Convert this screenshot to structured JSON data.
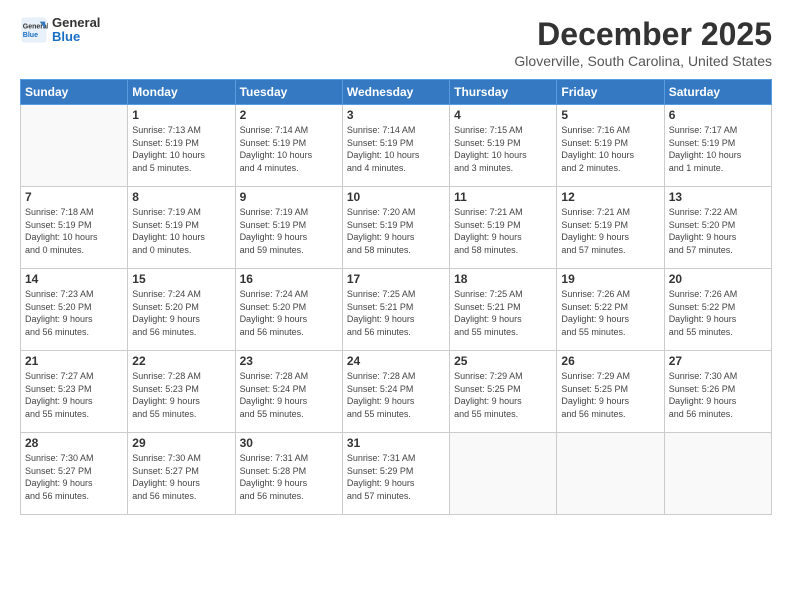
{
  "logo": {
    "line1": "General",
    "line2": "Blue"
  },
  "title": "December 2025",
  "location": "Gloverville, South Carolina, United States",
  "weekdays": [
    "Sunday",
    "Monday",
    "Tuesday",
    "Wednesday",
    "Thursday",
    "Friday",
    "Saturday"
  ],
  "weeks": [
    [
      {
        "day": "",
        "info": ""
      },
      {
        "day": "1",
        "info": "Sunrise: 7:13 AM\nSunset: 5:19 PM\nDaylight: 10 hours\nand 5 minutes."
      },
      {
        "day": "2",
        "info": "Sunrise: 7:14 AM\nSunset: 5:19 PM\nDaylight: 10 hours\nand 4 minutes."
      },
      {
        "day": "3",
        "info": "Sunrise: 7:14 AM\nSunset: 5:19 PM\nDaylight: 10 hours\nand 4 minutes."
      },
      {
        "day": "4",
        "info": "Sunrise: 7:15 AM\nSunset: 5:19 PM\nDaylight: 10 hours\nand 3 minutes."
      },
      {
        "day": "5",
        "info": "Sunrise: 7:16 AM\nSunset: 5:19 PM\nDaylight: 10 hours\nand 2 minutes."
      },
      {
        "day": "6",
        "info": "Sunrise: 7:17 AM\nSunset: 5:19 PM\nDaylight: 10 hours\nand 1 minute."
      }
    ],
    [
      {
        "day": "7",
        "info": "Sunrise: 7:18 AM\nSunset: 5:19 PM\nDaylight: 10 hours\nand 0 minutes."
      },
      {
        "day": "8",
        "info": "Sunrise: 7:19 AM\nSunset: 5:19 PM\nDaylight: 10 hours\nand 0 minutes."
      },
      {
        "day": "9",
        "info": "Sunrise: 7:19 AM\nSunset: 5:19 PM\nDaylight: 9 hours\nand 59 minutes."
      },
      {
        "day": "10",
        "info": "Sunrise: 7:20 AM\nSunset: 5:19 PM\nDaylight: 9 hours\nand 58 minutes."
      },
      {
        "day": "11",
        "info": "Sunrise: 7:21 AM\nSunset: 5:19 PM\nDaylight: 9 hours\nand 58 minutes."
      },
      {
        "day": "12",
        "info": "Sunrise: 7:21 AM\nSunset: 5:19 PM\nDaylight: 9 hours\nand 57 minutes."
      },
      {
        "day": "13",
        "info": "Sunrise: 7:22 AM\nSunset: 5:20 PM\nDaylight: 9 hours\nand 57 minutes."
      }
    ],
    [
      {
        "day": "14",
        "info": "Sunrise: 7:23 AM\nSunset: 5:20 PM\nDaylight: 9 hours\nand 56 minutes."
      },
      {
        "day": "15",
        "info": "Sunrise: 7:24 AM\nSunset: 5:20 PM\nDaylight: 9 hours\nand 56 minutes."
      },
      {
        "day": "16",
        "info": "Sunrise: 7:24 AM\nSunset: 5:20 PM\nDaylight: 9 hours\nand 56 minutes."
      },
      {
        "day": "17",
        "info": "Sunrise: 7:25 AM\nSunset: 5:21 PM\nDaylight: 9 hours\nand 56 minutes."
      },
      {
        "day": "18",
        "info": "Sunrise: 7:25 AM\nSunset: 5:21 PM\nDaylight: 9 hours\nand 55 minutes."
      },
      {
        "day": "19",
        "info": "Sunrise: 7:26 AM\nSunset: 5:22 PM\nDaylight: 9 hours\nand 55 minutes."
      },
      {
        "day": "20",
        "info": "Sunrise: 7:26 AM\nSunset: 5:22 PM\nDaylight: 9 hours\nand 55 minutes."
      }
    ],
    [
      {
        "day": "21",
        "info": "Sunrise: 7:27 AM\nSunset: 5:23 PM\nDaylight: 9 hours\nand 55 minutes."
      },
      {
        "day": "22",
        "info": "Sunrise: 7:28 AM\nSunset: 5:23 PM\nDaylight: 9 hours\nand 55 minutes."
      },
      {
        "day": "23",
        "info": "Sunrise: 7:28 AM\nSunset: 5:24 PM\nDaylight: 9 hours\nand 55 minutes."
      },
      {
        "day": "24",
        "info": "Sunrise: 7:28 AM\nSunset: 5:24 PM\nDaylight: 9 hours\nand 55 minutes."
      },
      {
        "day": "25",
        "info": "Sunrise: 7:29 AM\nSunset: 5:25 PM\nDaylight: 9 hours\nand 55 minutes."
      },
      {
        "day": "26",
        "info": "Sunrise: 7:29 AM\nSunset: 5:25 PM\nDaylight: 9 hours\nand 56 minutes."
      },
      {
        "day": "27",
        "info": "Sunrise: 7:30 AM\nSunset: 5:26 PM\nDaylight: 9 hours\nand 56 minutes."
      }
    ],
    [
      {
        "day": "28",
        "info": "Sunrise: 7:30 AM\nSunset: 5:27 PM\nDaylight: 9 hours\nand 56 minutes."
      },
      {
        "day": "29",
        "info": "Sunrise: 7:30 AM\nSunset: 5:27 PM\nDaylight: 9 hours\nand 56 minutes."
      },
      {
        "day": "30",
        "info": "Sunrise: 7:31 AM\nSunset: 5:28 PM\nDaylight: 9 hours\nand 56 minutes."
      },
      {
        "day": "31",
        "info": "Sunrise: 7:31 AM\nSunset: 5:29 PM\nDaylight: 9 hours\nand 57 minutes."
      },
      {
        "day": "",
        "info": ""
      },
      {
        "day": "",
        "info": ""
      },
      {
        "day": "",
        "info": ""
      }
    ]
  ]
}
